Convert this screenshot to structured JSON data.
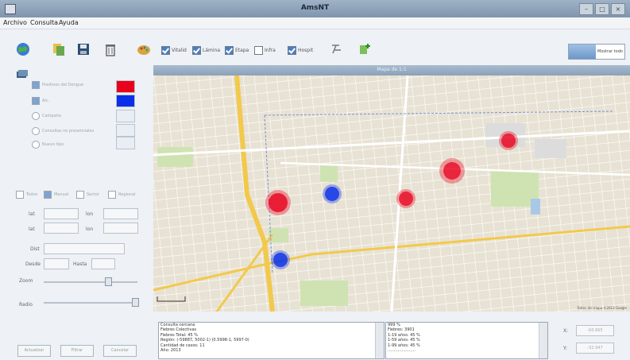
{
  "window": {
    "title": "AmsNT"
  },
  "menu": [
    "Archivo",
    "Consulta",
    "Ayuda"
  ],
  "toolbar": {
    "checks": [
      {
        "label": "Vitalid",
        "on": true
      },
      {
        "label": "Lámina",
        "on": true
      },
      {
        "label": "Etapa",
        "on": true
      },
      {
        "label": "Infra",
        "on": false
      },
      {
        "label": "Hospit",
        "on": true
      }
    ],
    "view_label": "Mostrar todo"
  },
  "left": {
    "options": [
      {
        "label": "Positivos del Dengue",
        "type": "check",
        "on": true,
        "color": "#e8001c"
      },
      {
        "label": "Alc.",
        "type": "check",
        "on": true,
        "color": "#0a2fe8"
      },
      {
        "label": "Campaña",
        "type": "radio",
        "on": false,
        "color": "#e9eef4"
      },
      {
        "label": "Consultas no presenciales",
        "type": "radio",
        "on": false,
        "color": "#e9eef4"
      },
      {
        "label": "Nuevo tipo",
        "type": "radio",
        "on": false,
        "color": "#e9eef4"
      }
    ],
    "filters": [
      "Todos",
      "Manual",
      "Sector",
      "Regional"
    ],
    "coords": {
      "lat_label": "lat",
      "lon_label": "lon",
      "lat2_label": "lat",
      "lon2_label": "lon"
    },
    "date_labels": {
      "desde": "Desde",
      "hasta": "Hasta"
    },
    "zoom_label": "Zoom",
    "radio_label": "Radio",
    "buttons": [
      "Actualizar",
      "Filtrar",
      "Cancelar"
    ],
    "dist_label": "Dist"
  },
  "map": {
    "title": "Mapa de 1:1",
    "markers": [
      {
        "color": "red",
        "size": 3
      },
      {
        "color": "blue",
        "size": 2
      },
      {
        "color": "red",
        "size": 2
      },
      {
        "color": "red",
        "size": 3
      },
      {
        "color": "red",
        "size": 2
      },
      {
        "color": "blue",
        "size": 2
      }
    ],
    "attribution": "Datos del mapa ©2013 Google"
  },
  "info": {
    "left_lines": [
      "Consulta cercana",
      "Fiebres Colectivas",
      "Fiebres Total: 45 %",
      "Región: (-59887, 5002-1) (0.5998-1, 5997-0)",
      "Cantidad de casos: 11",
      "Año: 2013"
    ],
    "right_lines": [
      "999 %",
      "Fiebres: 3901",
      "1-19 años: 45 %",
      "1-59 años: 45 %",
      "1-99 años: 45 %",
      "......................"
    ],
    "x_label": "X:",
    "y_label": "Y:",
    "x_value": "-60.665",
    "y_value": "-32.947"
  }
}
